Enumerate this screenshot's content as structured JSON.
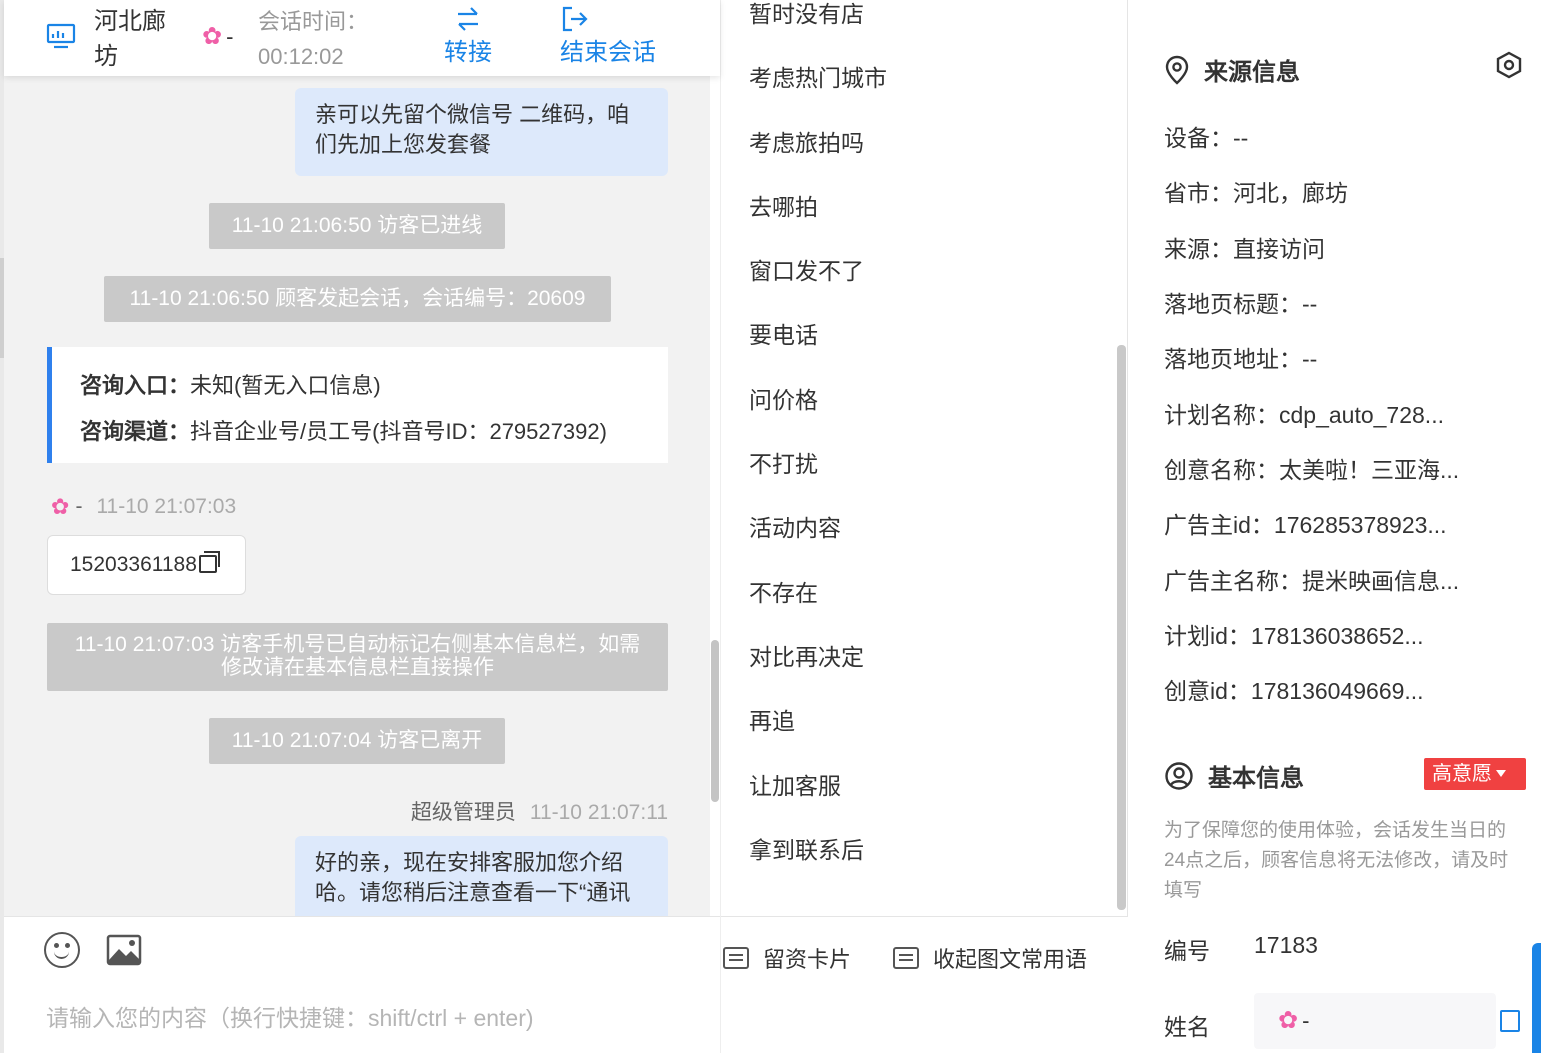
{
  "header": {
    "location": "河北廊坊",
    "visitor_name": "-",
    "session_time_label": "会话时间：",
    "session_time": "00:12:02",
    "transfer_label": "转接",
    "end_session_label": "结束会话"
  },
  "messages": {
    "agent_msg_1": "亲可以先留个微信号 二维码，咱们先加上您发套餐",
    "sys_1": "11-10 21:06:50 访客已进线",
    "sys_2": "11-10 21:06:50 顾客发起会话，会话编号：20609",
    "card_entry_label": "咨询入口：",
    "card_entry_value": "未知(暂无入口信息)",
    "card_channel_label": "咨询渠道：",
    "card_channel_value": "抖音企业号/员工号(抖音号ID：279527392)",
    "visitor_name": "-",
    "visitor_time": "11-10 21:07:03",
    "phone": "15203361188",
    "sys_3": "11-10 21:07:03 访客手机号已自动标记右侧基本信息栏，如需修改请在基本信息栏直接操作",
    "sys_4": "11-10 21:07:04 访客已离开",
    "agent_name": "超级管理员",
    "agent_time": "11-10 21:07:11",
    "agent_msg_2": "好的亲，现在安排客服加您介绍哈。请您稍后注意查看一下“通讯"
  },
  "input": {
    "placeholder": "请输入您的内容（换行快捷键：shift/ctrl + enter)"
  },
  "quick_replies": [
    "暂时没有店",
    "考虑热门城市",
    "考虑旅拍吗",
    "去哪拍",
    "窗口发不了",
    "要电话",
    "问价格",
    "不打扰",
    "活动内容",
    "不存在",
    "对比再决定",
    "再追",
    "让加客服",
    "拿到联系后"
  ],
  "toolbar": {
    "lead_card_label": "留资卡片",
    "collapse_phrases_label": "收起图文常用语"
  },
  "source_info": {
    "title": "来源信息",
    "device": "设备：--",
    "region": "省市：河北，廊坊",
    "source": "来源：直接访问",
    "landing_title": "落地页标题：--",
    "landing_url": "落地页地址：--",
    "plan_name": "计划名称：cdp_auto_728...",
    "creative_name": "创意名称：太美啦！三亚海...",
    "advertiser_id": "广告主id：176285378923...",
    "advertiser_name": "广告主名称：提米映画信息...",
    "plan_id": "计划id：178136038652...",
    "creative_id": "创意id：178136049669..."
  },
  "basic_info": {
    "title": "基本信息",
    "intent_badge": "高意愿",
    "hint": "为了保障您的使用体验，会话发生当日的24点之后，顾客信息将无法修改，请及时填写",
    "id_label": "编号",
    "id_value": "17183",
    "name_label": "姓名",
    "name_value": "-"
  },
  "colors": {
    "accent": "#1a84e6",
    "agent_bubble": "#dde9fb",
    "system_msg": "#c9c9c9",
    "badge": "#f04141",
    "avatar": "#ef5fa7"
  }
}
